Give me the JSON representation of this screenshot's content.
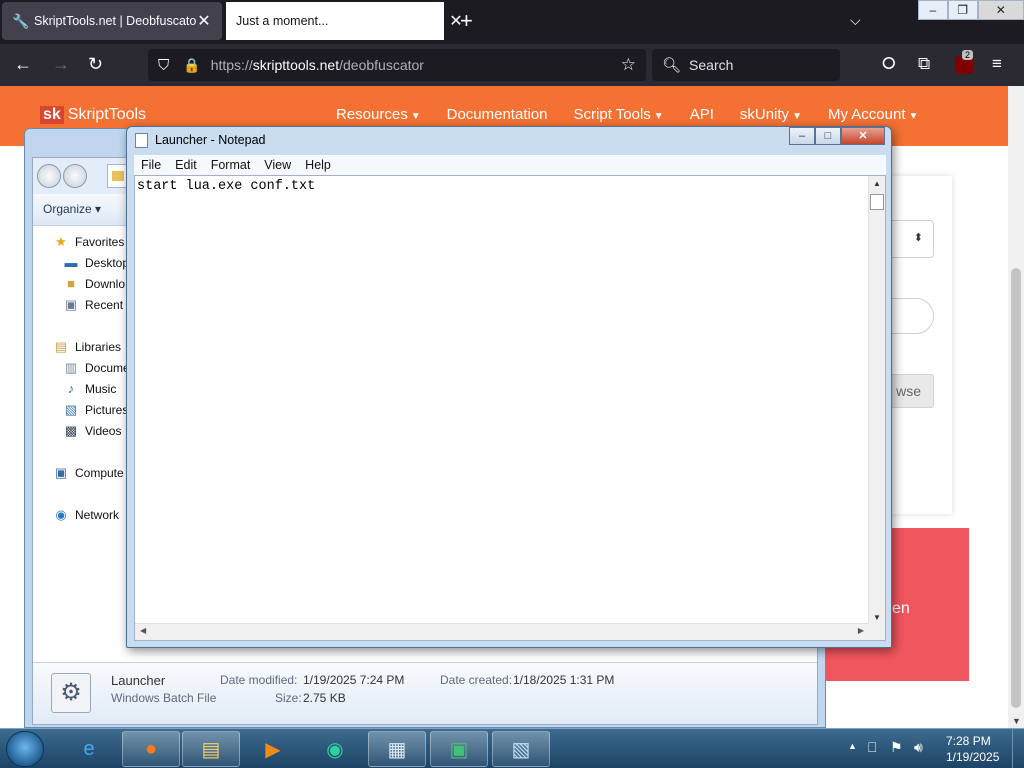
{
  "browser": {
    "tabs": [
      {
        "title": "SkriptTools.net | Deobfuscator",
        "active": true
      },
      {
        "title": "Just a moment...",
        "active": false
      }
    ],
    "url_prefix": "https://",
    "url_domain": "skripttools.net",
    "url_path": "/deobfuscator",
    "search_placeholder": "Search",
    "extension_badge": "2"
  },
  "site": {
    "logo_mark": "sk",
    "logo_text": "SkriptTools",
    "nav": [
      {
        "label": "Resources",
        "dropdown": true
      },
      {
        "label": "Documentation",
        "dropdown": false
      },
      {
        "label": "Script Tools",
        "dropdown": true
      },
      {
        "label": "API",
        "dropdown": false
      },
      {
        "label": "skUnity",
        "dropdown": true
      },
      {
        "label": "My Account",
        "dropdown": true
      }
    ],
    "browse_label_partial": "wse",
    "red_card_text_partial": "en",
    "colors": {
      "header": "#f47133",
      "red_card": "#f0565e"
    }
  },
  "explorer": {
    "organize_label": "Organize",
    "nav_items": [
      {
        "label": "Favorites",
        "icon": "star-icon"
      },
      {
        "label": "Desktop",
        "icon": "desktop-icon"
      },
      {
        "label": "Downlo",
        "icon": "downloads-icon"
      },
      {
        "label": "Recent",
        "icon": "recent-places-icon"
      },
      {
        "label": "Libraries",
        "icon": "library-icon"
      },
      {
        "label": "Docume",
        "icon": "documents-icon"
      },
      {
        "label": "Music",
        "icon": "music-icon"
      },
      {
        "label": "Pictures",
        "icon": "pictures-icon"
      },
      {
        "label": "Videos",
        "icon": "videos-icon"
      },
      {
        "label": "Compute",
        "icon": "computer-icon"
      },
      {
        "label": "Network",
        "icon": "network-icon"
      }
    ],
    "details": {
      "file_name": "Launcher",
      "file_type": "Windows Batch File",
      "modified_label": "Date modified:",
      "modified_value": "1/19/2025 7:24 PM",
      "created_label": "Date created:",
      "created_value": "1/18/2025 1:31 PM",
      "size_label": "Size:",
      "size_value": "2.75 KB"
    }
  },
  "notepad": {
    "title": "Launcher - Notepad",
    "menu": [
      "File",
      "Edit",
      "Format",
      "View",
      "Help"
    ],
    "content": "start lua.exe conf.txt"
  },
  "taskbar": {
    "apps": [
      {
        "name": "internet-explorer",
        "open": false
      },
      {
        "name": "firefox",
        "open": true
      },
      {
        "name": "windows-explorer",
        "open": true
      },
      {
        "name": "media-player",
        "open": false
      },
      {
        "name": "app-circle",
        "open": false
      },
      {
        "name": "control-panel",
        "open": true
      },
      {
        "name": "terminal",
        "open": true
      },
      {
        "name": "notepad",
        "open": true
      }
    ],
    "time": "7:28 PM",
    "date": "1/19/2025"
  }
}
